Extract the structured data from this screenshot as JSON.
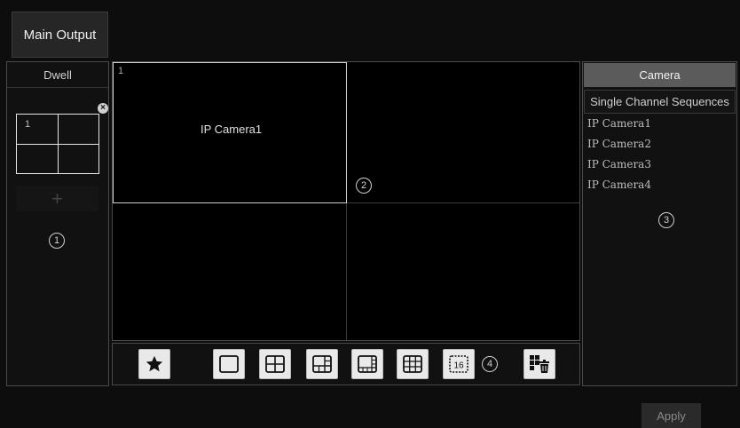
{
  "tabs": {
    "main_output": "Main Output"
  },
  "dwell": {
    "header": "Dwell",
    "thumbnail_index": "1",
    "close_symbol": "×",
    "add_symbol": "+"
  },
  "markers": {
    "one": "1",
    "two": "2",
    "three": "3",
    "four": "4"
  },
  "grid": {
    "cell1_index": "1",
    "cell1_label": "IP Camera1"
  },
  "right_panel": {
    "tab_camera": "Camera",
    "tab_sequences": "Single Channel Sequences",
    "cameras": [
      "IP Camera1",
      "IP Camera2",
      "IP Camera3",
      "IP Camera4"
    ]
  },
  "toolbar": {
    "favorite_icon": "star-icon",
    "layouts": [
      "1",
      "4",
      "6",
      "8",
      "9",
      "16"
    ],
    "layout16_label": "16",
    "clear_icon": "clear-layout-icon"
  },
  "footer": {
    "apply_label": "Apply"
  }
}
